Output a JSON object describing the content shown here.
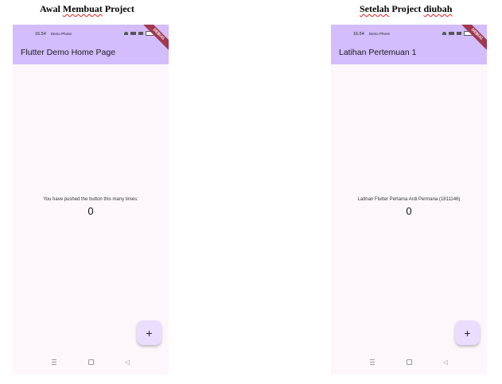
{
  "left": {
    "caption": {
      "before": "Awal ",
      "squiggly": "Membuat",
      "after": " Project"
    },
    "status": {
      "time": "16.54",
      "carrier": "Demo Phone"
    },
    "debug_banner": "DEBUG",
    "appbar_title": "Flutter Demo Home Page",
    "body_text": "You have pushed the button this many times:",
    "counter": "0",
    "fab_icon": "+"
  },
  "right": {
    "caption": {
      "before": "",
      "squiggly": "Setelah",
      "after": " Project ",
      "squiggly2": "diubah"
    },
    "status": {
      "time": "16.54",
      "carrier": "Demo Phone"
    },
    "debug_banner": "DEBUG",
    "appbar_title": "Latihan Pertemuan 1",
    "body_text": "Latihan Flutter Pertama Ardi Permana (1811146)",
    "counter": "0",
    "fab_icon": "+"
  },
  "nav": {
    "back_icon": "◁"
  },
  "colors": {
    "appbar": "#d3bdfc",
    "background": "#fdf7fc",
    "fab": "#eaddff",
    "debug_banner": "#a0384f"
  }
}
